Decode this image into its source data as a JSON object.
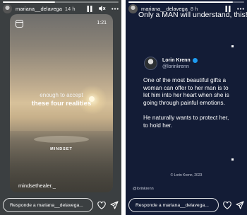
{
  "left_story": {
    "username": "mariana__delavega",
    "time": "14 h",
    "progress": 0.45,
    "media": {
      "duration": "1:21",
      "caption_top": "enough to accept",
      "caption_main": "these four realities",
      "watermark": "MINDSET",
      "handle": "mindsethealer._"
    },
    "reply_placeholder": "Responde a mariana__delavega..."
  },
  "right_story": {
    "username": "mariana__delavega",
    "time": "8 h",
    "progress": 0.9,
    "headline": "Only a MAN will understand, this!",
    "tweet": {
      "name": "Lorin Krenn",
      "handle": "@lorinkrenn",
      "paragraphs": [
        "One of the most beautiful gifts a woman can offer to her man is to let him into her heart when she is going through painful emotions.",
        "He naturally wants to protect her, to hold her."
      ]
    },
    "copyright": "© Lorin Krenn, 2023",
    "source_handle": "@lorinkrenn",
    "reply_placeholder": "Responde a mariana__delavega..."
  },
  "icons": {
    "pause": "pause-icon",
    "mute": "speaker-mute-icon",
    "more": "more-options-icon",
    "heart": "heart-icon",
    "send": "send-icon"
  },
  "colors": {
    "left_background": "#3b3f41",
    "right_background": "#131c36",
    "verified": "#1d9bf0"
  }
}
